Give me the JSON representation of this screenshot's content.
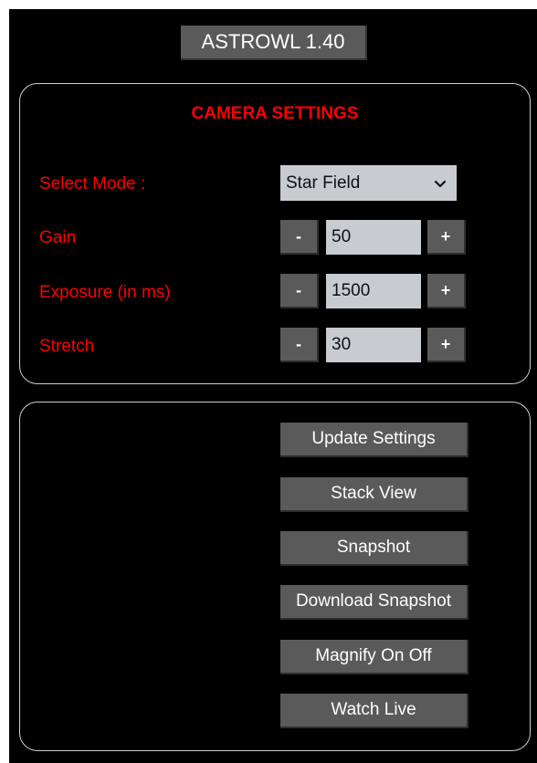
{
  "app": {
    "title": "ASTROWL 1.40"
  },
  "camera_settings": {
    "heading": "CAMERA SETTINGS",
    "mode": {
      "label": "Select Mode :",
      "selected": "Star Field"
    },
    "gain": {
      "label": "Gain",
      "value": "50",
      "minus": "-",
      "plus": "+"
    },
    "exposure": {
      "label": "Exposure (in ms)",
      "value": "1500",
      "minus": "-",
      "plus": "+"
    },
    "stretch": {
      "label": "Stretch",
      "value": "30",
      "minus": "-",
      "plus": "+"
    }
  },
  "actions": {
    "update_settings": "Update Settings",
    "stack_view": "Stack View",
    "snapshot": "Snapshot",
    "download_snapshot": "Download Snapshot",
    "magnify": "Magnify On Off",
    "watch_live": "Watch Live"
  },
  "colors": {
    "background": "#000000",
    "label_red": "#ff0000",
    "button_grey": "#5a5a5a",
    "field_grey": "#c8ccd0",
    "panel_border": "#d0d0d0"
  },
  "icons": {
    "select_arrow": "chevron-down-icon"
  }
}
